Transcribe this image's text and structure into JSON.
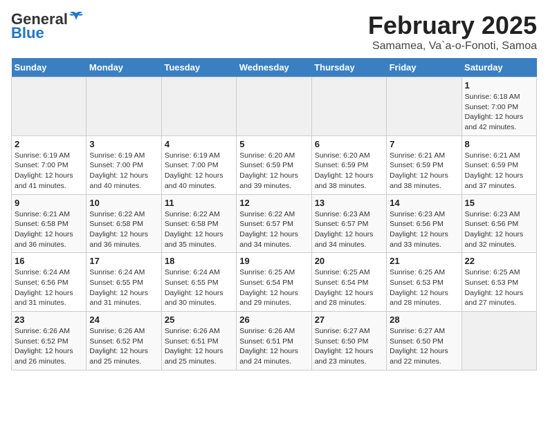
{
  "header": {
    "logo_general": "General",
    "logo_blue": "Blue",
    "title": "February 2025",
    "subtitle": "Samamea, Va`a-o-Fonoti, Samoa"
  },
  "days_of_week": [
    "Sunday",
    "Monday",
    "Tuesday",
    "Wednesday",
    "Thursday",
    "Friday",
    "Saturday"
  ],
  "weeks": [
    [
      {
        "day": "",
        "info": ""
      },
      {
        "day": "",
        "info": ""
      },
      {
        "day": "",
        "info": ""
      },
      {
        "day": "",
        "info": ""
      },
      {
        "day": "",
        "info": ""
      },
      {
        "day": "",
        "info": ""
      },
      {
        "day": "1",
        "info": "Sunrise: 6:18 AM\nSunset: 7:00 PM\nDaylight: 12 hours\nand 42 minutes."
      }
    ],
    [
      {
        "day": "2",
        "info": "Sunrise: 6:19 AM\nSunset: 7:00 PM\nDaylight: 12 hours\nand 41 minutes."
      },
      {
        "day": "3",
        "info": "Sunrise: 6:19 AM\nSunset: 7:00 PM\nDaylight: 12 hours\nand 40 minutes."
      },
      {
        "day": "4",
        "info": "Sunrise: 6:19 AM\nSunset: 7:00 PM\nDaylight: 12 hours\nand 40 minutes."
      },
      {
        "day": "5",
        "info": "Sunrise: 6:20 AM\nSunset: 6:59 PM\nDaylight: 12 hours\nand 39 minutes."
      },
      {
        "day": "6",
        "info": "Sunrise: 6:20 AM\nSunset: 6:59 PM\nDaylight: 12 hours\nand 38 minutes."
      },
      {
        "day": "7",
        "info": "Sunrise: 6:21 AM\nSunset: 6:59 PM\nDaylight: 12 hours\nand 38 minutes."
      },
      {
        "day": "8",
        "info": "Sunrise: 6:21 AM\nSunset: 6:59 PM\nDaylight: 12 hours\nand 37 minutes."
      }
    ],
    [
      {
        "day": "9",
        "info": "Sunrise: 6:21 AM\nSunset: 6:58 PM\nDaylight: 12 hours\nand 36 minutes."
      },
      {
        "day": "10",
        "info": "Sunrise: 6:22 AM\nSunset: 6:58 PM\nDaylight: 12 hours\nand 36 minutes."
      },
      {
        "day": "11",
        "info": "Sunrise: 6:22 AM\nSunset: 6:58 PM\nDaylight: 12 hours\nand 35 minutes."
      },
      {
        "day": "12",
        "info": "Sunrise: 6:22 AM\nSunset: 6:57 PM\nDaylight: 12 hours\nand 34 minutes."
      },
      {
        "day": "13",
        "info": "Sunrise: 6:23 AM\nSunset: 6:57 PM\nDaylight: 12 hours\nand 34 minutes."
      },
      {
        "day": "14",
        "info": "Sunrise: 6:23 AM\nSunset: 6:56 PM\nDaylight: 12 hours\nand 33 minutes."
      },
      {
        "day": "15",
        "info": "Sunrise: 6:23 AM\nSunset: 6:56 PM\nDaylight: 12 hours\nand 32 minutes."
      }
    ],
    [
      {
        "day": "16",
        "info": "Sunrise: 6:24 AM\nSunset: 6:56 PM\nDaylight: 12 hours\nand 31 minutes."
      },
      {
        "day": "17",
        "info": "Sunrise: 6:24 AM\nSunset: 6:55 PM\nDaylight: 12 hours\nand 31 minutes."
      },
      {
        "day": "18",
        "info": "Sunrise: 6:24 AM\nSunset: 6:55 PM\nDaylight: 12 hours\nand 30 minutes."
      },
      {
        "day": "19",
        "info": "Sunrise: 6:25 AM\nSunset: 6:54 PM\nDaylight: 12 hours\nand 29 minutes."
      },
      {
        "day": "20",
        "info": "Sunrise: 6:25 AM\nSunset: 6:54 PM\nDaylight: 12 hours\nand 28 minutes."
      },
      {
        "day": "21",
        "info": "Sunrise: 6:25 AM\nSunset: 6:53 PM\nDaylight: 12 hours\nand 28 minutes."
      },
      {
        "day": "22",
        "info": "Sunrise: 6:25 AM\nSunset: 6:53 PM\nDaylight: 12 hours\nand 27 minutes."
      }
    ],
    [
      {
        "day": "23",
        "info": "Sunrise: 6:26 AM\nSunset: 6:52 PM\nDaylight: 12 hours\nand 26 minutes."
      },
      {
        "day": "24",
        "info": "Sunrise: 6:26 AM\nSunset: 6:52 PM\nDaylight: 12 hours\nand 25 minutes."
      },
      {
        "day": "25",
        "info": "Sunrise: 6:26 AM\nSunset: 6:51 PM\nDaylight: 12 hours\nand 25 minutes."
      },
      {
        "day": "26",
        "info": "Sunrise: 6:26 AM\nSunset: 6:51 PM\nDaylight: 12 hours\nand 24 minutes."
      },
      {
        "day": "27",
        "info": "Sunrise: 6:27 AM\nSunset: 6:50 PM\nDaylight: 12 hours\nand 23 minutes."
      },
      {
        "day": "28",
        "info": "Sunrise: 6:27 AM\nSunset: 6:50 PM\nDaylight: 12 hours\nand 22 minutes."
      },
      {
        "day": "",
        "info": ""
      }
    ]
  ]
}
